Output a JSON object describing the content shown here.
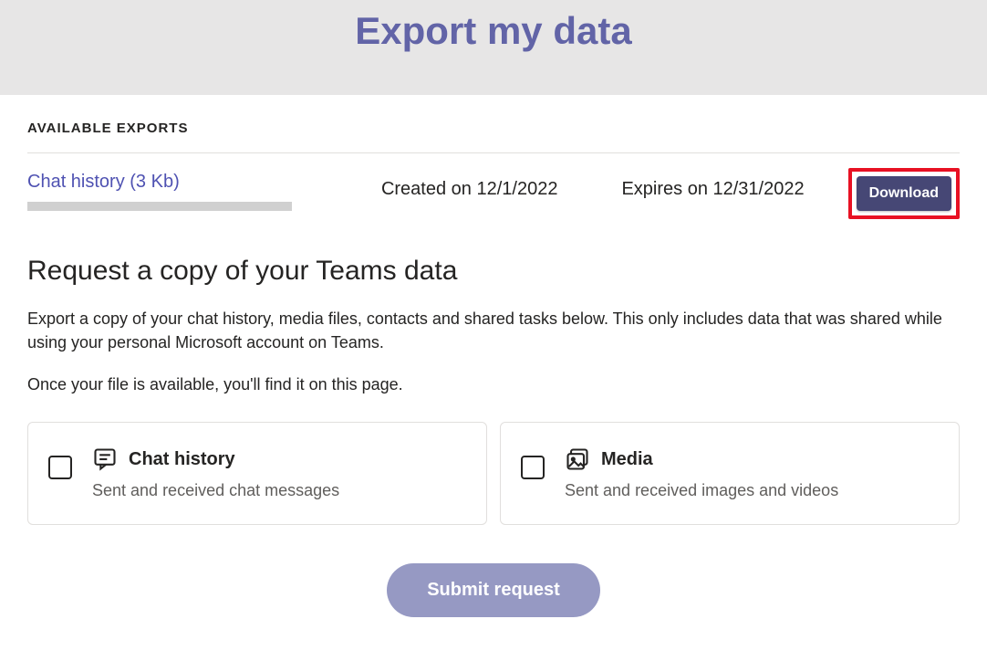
{
  "header": {
    "title": "Export my data"
  },
  "section": {
    "label": "AVAILABLE EXPORTS"
  },
  "export": {
    "link_text": "Chat history (3 Kb)",
    "created": "Created on 12/1/2022",
    "expires": "Expires on 12/31/2022",
    "download_label": "Download"
  },
  "request": {
    "heading": "Request a copy of your Teams data",
    "description": "Export a copy of your chat history, media files, contacts and shared tasks below. This only includes data that was shared while using your personal Microsoft account on Teams.",
    "note": "Once your file is available, you'll find it on this page."
  },
  "cards": {
    "chat": {
      "title": "Chat history",
      "sub": "Sent and received chat messages"
    },
    "media": {
      "title": "Media",
      "sub": "Sent and received images and videos"
    }
  },
  "submit": {
    "label": "Submit request"
  }
}
